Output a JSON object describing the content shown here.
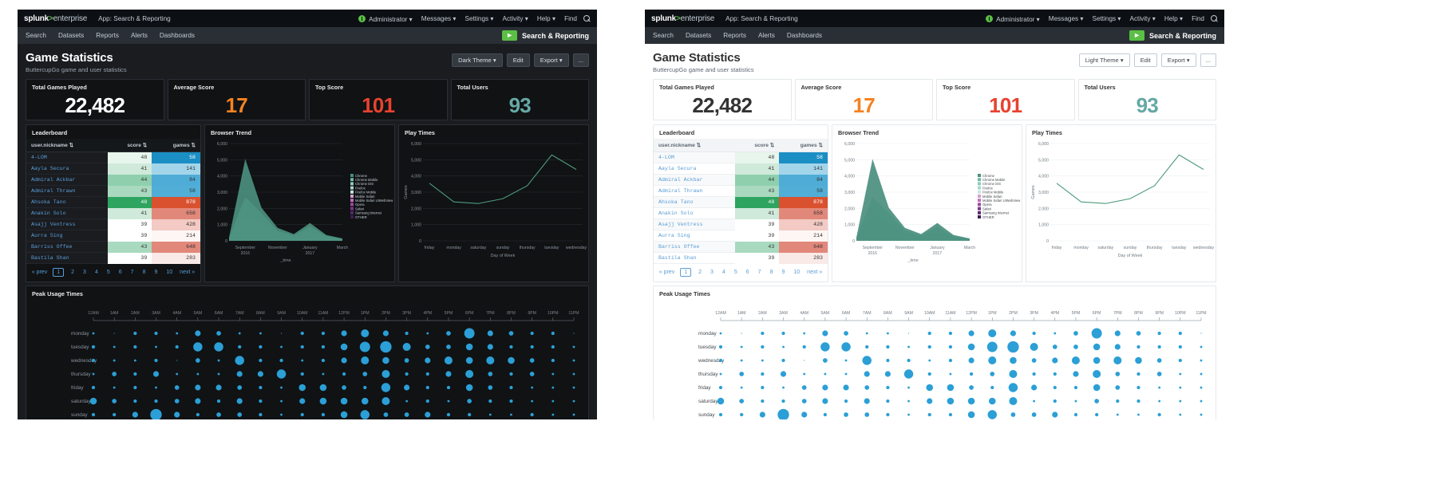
{
  "nav": {
    "brand_splunk": "splunk",
    "brand_gt": ">",
    "brand_enterprise": "enterprise",
    "app_selector": "App: Search & Reporting",
    "items": [
      "Administrator",
      "Messages",
      "Settings",
      "Activity",
      "Help"
    ],
    "find_label": "Find",
    "search_icon": "search-icon"
  },
  "appbar": {
    "tabs": [
      "Search",
      "Datasets",
      "Reports",
      "Alerts",
      "Dashboards"
    ],
    "app_badge": "play-icon",
    "app_label": "Search & Reporting"
  },
  "page": {
    "title": "Game Statistics",
    "subtitle": "ButtercupGo game and user statistics"
  },
  "actions_dark": {
    "theme": "Dark Theme",
    "edit": "Edit",
    "export": "Export",
    "more": "..."
  },
  "actions_light": {
    "theme": "Light Theme",
    "edit": "Edit",
    "export": "Export",
    "more": "..."
  },
  "kpis": [
    {
      "title": "Total Games Played",
      "value": "22,482",
      "color_dark": "#ffffff",
      "color_light": "#333333"
    },
    {
      "title": "Average Score",
      "value": "17",
      "color_dark": "#f58220",
      "color_light": "#f58220"
    },
    {
      "title": "Top Score",
      "value": "101",
      "color_dark": "#e8422e",
      "color_light": "#e8422e"
    },
    {
      "title": "Total Users",
      "value": "93",
      "color_dark": "#65a8a5",
      "color_light": "#65a8a5"
    }
  ],
  "leaderboard": {
    "title": "Leaderboard",
    "columns": [
      "user.nickname",
      "score",
      "games"
    ],
    "sort_glyph": "sort-icon",
    "rows": [
      {
        "name": "4-LOM",
        "score": 48,
        "games": 58,
        "score_bg": "#e8f5ec",
        "games_bg": "#1b8ec4"
      },
      {
        "name": "Aayla Secura",
        "score": 41,
        "games": 141,
        "score_bg": "#cfe9da",
        "games_bg": "#a3d5ea"
      },
      {
        "name": "Admiral Ackbar",
        "score": 44,
        "games": 84,
        "score_bg": "#8fcfae",
        "games_bg": "#4facd6"
      },
      {
        "name": "Admiral Thrawn",
        "score": 43,
        "games": 58,
        "score_bg": "#a9d9bf",
        "games_bg": "#50aed7"
      },
      {
        "name": "Ahsoka Tano",
        "score": 48,
        "games": 878,
        "score_bg": "#2da45f",
        "games_bg": "#d9512f"
      },
      {
        "name": "Anakin Solo",
        "score": 41,
        "games": 658,
        "score_bg": "#cfe9da",
        "games_bg": "#e2887a"
      },
      {
        "name": "Asajj Ventress",
        "score": 39,
        "games": 428,
        "score_bg": "#ffffff",
        "games_bg": "#f3cac4"
      },
      {
        "name": "Aurra Sing",
        "score": 39,
        "games": 214,
        "score_bg": "#ffffff",
        "games_bg": "#fdf6f4"
      },
      {
        "name": "Barriss Offee",
        "score": 43,
        "games": 648,
        "score_bg": "#a9d9bf",
        "games_bg": "#e2887a"
      },
      {
        "name": "Bastila Shan",
        "score": 39,
        "games": 283,
        "score_bg": "#ffffff",
        "games_bg": "#faeae7"
      }
    ],
    "pager": {
      "prev": "« prev",
      "pages": [
        "1",
        "2",
        "3",
        "4",
        "5",
        "6",
        "7",
        "8",
        "9",
        "10"
      ],
      "next": "next »",
      "current": "1"
    }
  },
  "chart_data": [
    {
      "id": "browser-trend",
      "type": "area",
      "title": "Browser Trend",
      "xlabel": "_time",
      "ylabel": "",
      "ylim": [
        0,
        6000
      ],
      "yticks": [
        0,
        1000,
        2000,
        3000,
        4000,
        5000,
        6000
      ],
      "ytick_labels": [
        "0",
        "1,000",
        "2,000",
        "3,000",
        "4,000",
        "5,000",
        "6,000"
      ],
      "x_tick_labels": [
        "September 2016",
        "November",
        "January 2017",
        "March"
      ],
      "legend_position": "right",
      "series": [
        {
          "name": "Chrome",
          "color": "#4b8f7e",
          "values": [
            200,
            5050,
            2050,
            800,
            420,
            1100,
            360,
            150
          ]
        },
        {
          "name": "Chrome Mobile",
          "color": "#6fb8a8",
          "values": [
            170,
            2700,
            1700,
            620,
            330,
            880,
            280,
            120
          ]
        },
        {
          "name": "Chrome iOS",
          "color": "#8ec9bb",
          "values": [
            140,
            1500,
            1100,
            470,
            250,
            560,
            210,
            90
          ]
        },
        {
          "name": "Firefox",
          "color": "#a8d8cd",
          "values": [
            110,
            980,
            720,
            330,
            180,
            400,
            150,
            70
          ]
        },
        {
          "name": "Firefox Mobile",
          "color": "#c7e6de",
          "values": [
            80,
            620,
            470,
            220,
            120,
            270,
            110,
            50
          ]
        },
        {
          "name": "Mobile Safari",
          "color": "#d59ed0",
          "values": [
            60,
            430,
            320,
            160,
            90,
            190,
            80,
            35
          ]
        },
        {
          "name": "Mobile Safari UIWebView",
          "color": "#c06ebb",
          "values": [
            45,
            300,
            230,
            110,
            60,
            130,
            55,
            25
          ]
        },
        {
          "name": "Opera",
          "color": "#9c4aa0",
          "values": [
            30,
            200,
            150,
            75,
            40,
            90,
            38,
            18
          ]
        },
        {
          "name": "Safari",
          "color": "#7b3688",
          "values": [
            20,
            130,
            100,
            50,
            26,
            60,
            25,
            12
          ]
        },
        {
          "name": "Samsung Internet",
          "color": "#5a2870",
          "values": [
            12,
            80,
            62,
            32,
            16,
            38,
            16,
            8
          ]
        },
        {
          "name": "OTHER",
          "color": "#3e1c55",
          "values": [
            6,
            40,
            30,
            16,
            8,
            18,
            8,
            4
          ]
        }
      ]
    },
    {
      "id": "play-times",
      "type": "line",
      "title": "Play Times",
      "xlabel": "Day of Week",
      "ylabel": "Games",
      "ylim": [
        0,
        6000
      ],
      "yticks": [
        0,
        1000,
        2000,
        3000,
        4000,
        5000,
        6000
      ],
      "ytick_labels": [
        "0",
        "1,000",
        "2,000",
        "3,000",
        "4,000",
        "5,000",
        "6,000"
      ],
      "categories": [
        "friday",
        "monday",
        "saturday",
        "sunday",
        "thursday",
        "tuesday",
        "wednesday"
      ],
      "values": [
        3550,
        2400,
        2300,
        2600,
        3400,
        5300,
        4400
      ],
      "line_color": "#4e9a7a"
    },
    {
      "id": "peak-usage-times",
      "type": "scatter",
      "title": "Peak Usage Times",
      "xlabel": "",
      "ylabel": "",
      "hours": [
        "12AM",
        "1AM",
        "2AM",
        "3AM",
        "4AM",
        "5AM",
        "6AM",
        "7AM",
        "8AM",
        "9AM",
        "10AM",
        "11AM",
        "12PM",
        "1PM",
        "2PM",
        "3PM",
        "4PM",
        "5PM",
        "6PM",
        "7PM",
        "8PM",
        "9PM",
        "10PM",
        "11PM"
      ],
      "days": [
        "monday",
        "tuesday",
        "wednesday",
        "thursday",
        "friday",
        "saturday",
        "sunday"
      ],
      "bubble_color": "#2b9fd6",
      "matrix": [
        [
          1,
          0,
          2,
          2,
          1,
          4,
          3,
          1,
          1,
          0,
          2,
          2,
          4,
          6,
          4,
          2,
          1,
          3,
          8,
          4,
          3,
          2,
          2,
          0
        ],
        [
          2,
          1,
          2,
          1,
          2,
          7,
          7,
          2,
          2,
          1,
          2,
          2,
          5,
          8,
          9,
          6,
          3,
          3,
          5,
          4,
          2,
          2,
          2,
          1
        ],
        [
          2,
          1,
          1,
          2,
          0,
          3,
          1,
          7,
          2,
          2,
          1,
          2,
          4,
          6,
          5,
          3,
          4,
          6,
          5,
          6,
          5,
          3,
          2,
          1
        ],
        [
          1,
          3,
          2,
          4,
          1,
          1,
          1,
          4,
          4,
          7,
          2,
          1,
          2,
          3,
          6,
          2,
          2,
          4,
          6,
          3,
          2,
          3,
          1,
          1
        ],
        [
          2,
          1,
          2,
          1,
          3,
          4,
          4,
          3,
          2,
          1,
          5,
          5,
          3,
          2,
          7,
          4,
          2,
          2,
          5,
          3,
          2,
          1,
          1,
          1
        ],
        [
          5,
          3,
          2,
          2,
          3,
          4,
          2,
          4,
          2,
          1,
          4,
          5,
          5,
          5,
          6,
          1,
          2,
          1,
          3,
          2,
          2,
          1,
          1,
          1
        ],
        [
          2,
          2,
          4,
          9,
          4,
          2,
          3,
          3,
          2,
          1,
          2,
          2,
          5,
          7,
          3,
          3,
          4,
          2,
          2,
          1,
          1,
          2,
          1,
          1
        ]
      ]
    }
  ]
}
